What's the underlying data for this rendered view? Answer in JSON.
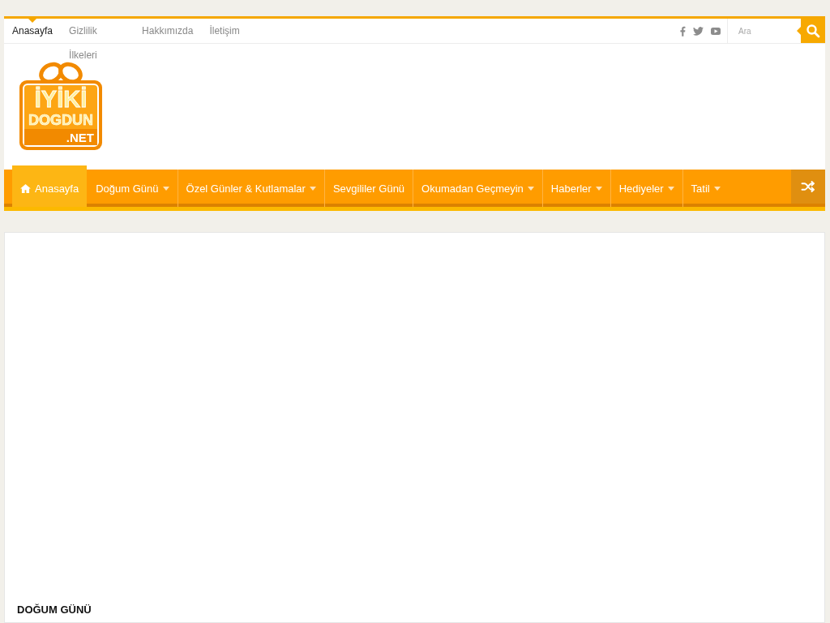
{
  "top_menu": [
    {
      "label": "Anasayfa",
      "selected": true
    },
    {
      "label": "Gizlilik İlkeleri",
      "selected": false
    },
    {
      "label": "Hakkımızda",
      "selected": false
    },
    {
      "label": "İletişim",
      "selected": false
    }
  ],
  "search": {
    "placeholder": "Ara"
  },
  "logo": {
    "lines": [
      "İYİKİ",
      "DOGDUN",
      ".NET"
    ]
  },
  "main_menu": [
    {
      "label": "Anasayfa",
      "kind": "home",
      "selected": true,
      "dropdown": false
    },
    {
      "label": "Doğum Günü",
      "kind": "link",
      "selected": false,
      "dropdown": true
    },
    {
      "label": "Özel Günler & Kutlamalar",
      "kind": "link",
      "selected": false,
      "dropdown": true
    },
    {
      "label": "Sevgililer Günü",
      "kind": "link",
      "selected": false,
      "dropdown": false
    },
    {
      "label": "Okumadan Geçmeyin",
      "kind": "link",
      "selected": false,
      "dropdown": true
    },
    {
      "label": "Haberler",
      "kind": "link",
      "selected": false,
      "dropdown": true
    },
    {
      "label": "Hediyeler",
      "kind": "link",
      "selected": false,
      "dropdown": true
    },
    {
      "label": "Tatil",
      "kind": "link",
      "selected": false,
      "dropdown": true
    }
  ],
  "section": {
    "title": "DOĞUM GÜNÜ"
  }
}
